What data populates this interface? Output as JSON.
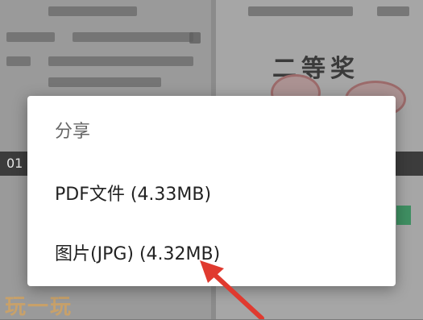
{
  "dialog": {
    "title": "分享",
    "options": [
      {
        "label": "PDF文件 (4.33MB)"
      },
      {
        "label": "图片(JPG) (4.32MB)"
      }
    ]
  },
  "background": {
    "certificate_title": "二等奖",
    "left_strip_text": "01",
    "watermark": "玩一玩"
  },
  "colors": {
    "overlay": "#8b8b8b",
    "dialog_bg": "#ffffff",
    "title_text": "#666666",
    "option_text": "#222222",
    "arrow": "#e03a2f"
  },
  "icons": [
    "arrow-pointer-icon"
  ]
}
